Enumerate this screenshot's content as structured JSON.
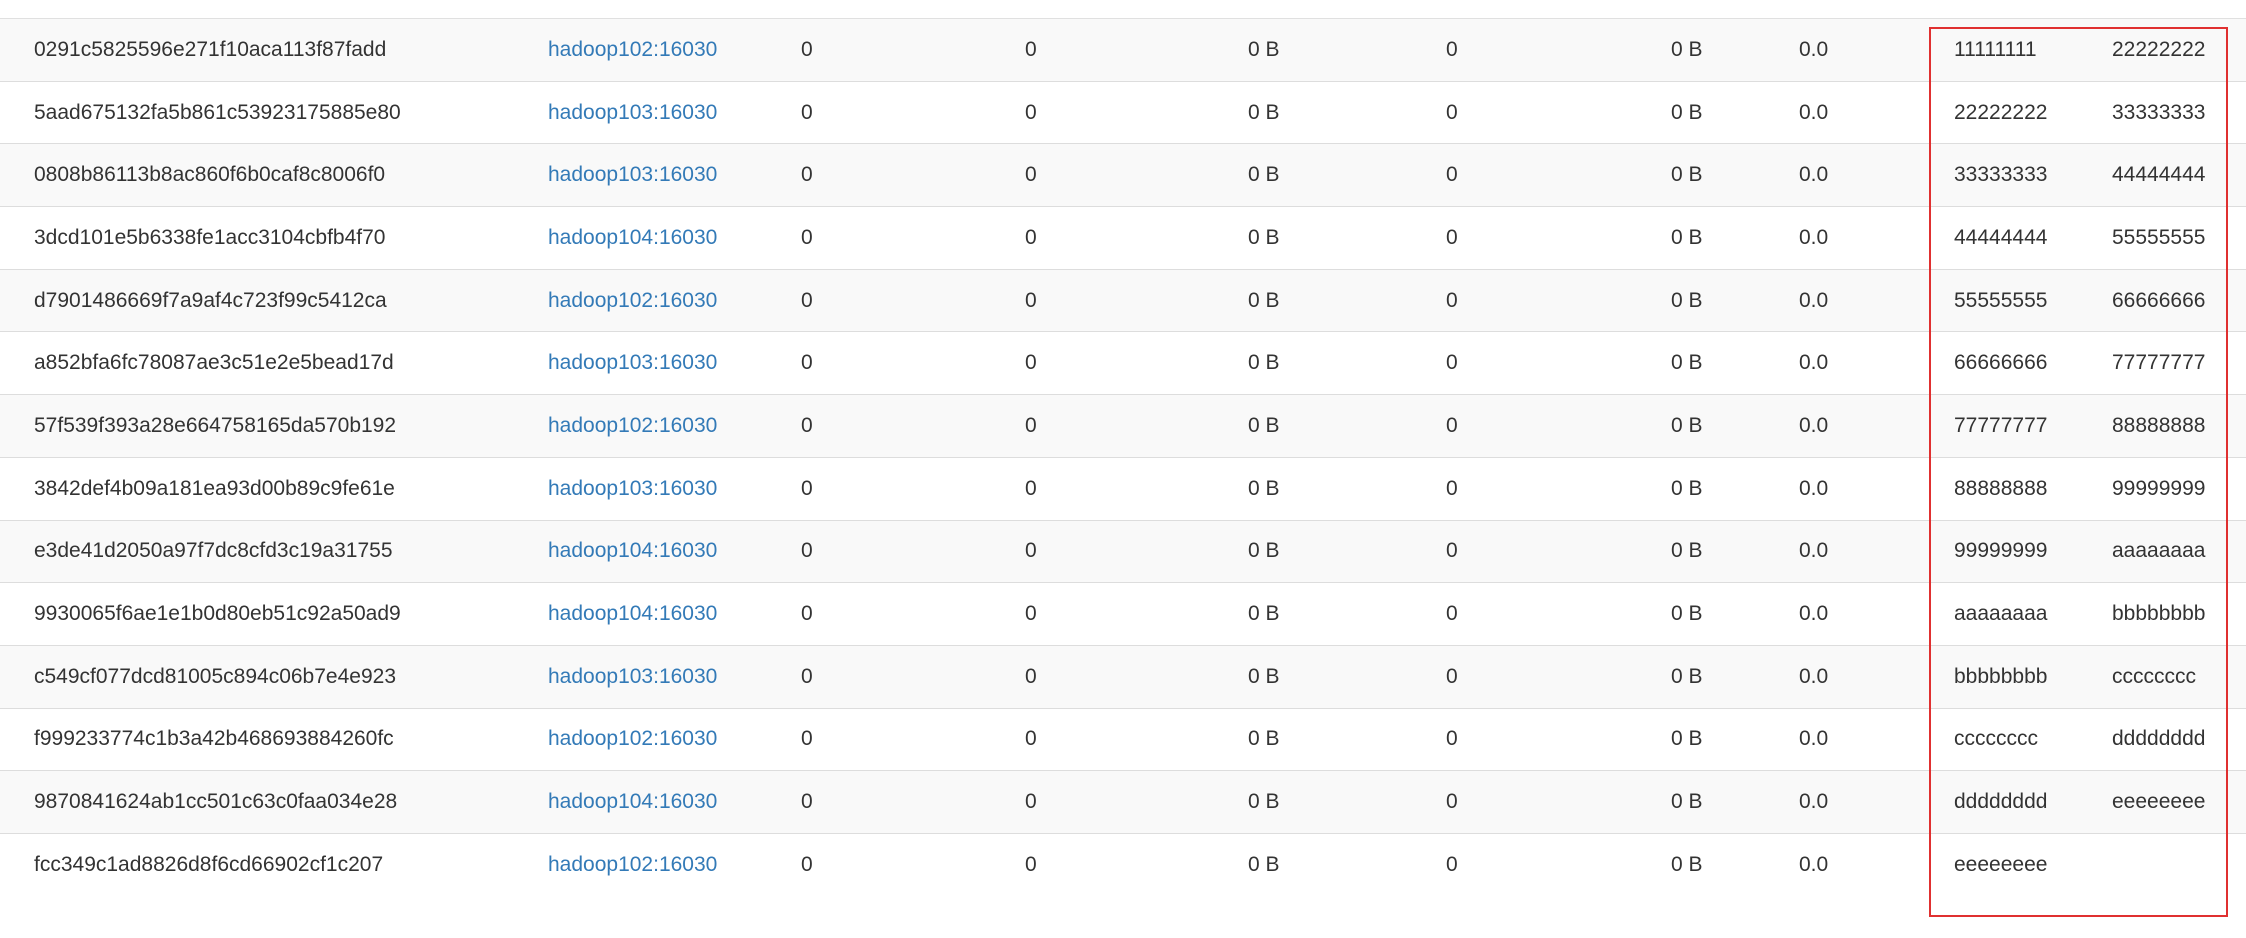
{
  "regions": {
    "rows": [
      {
        "name": "0291c5825596e271f10aca113f87fadd",
        "server": "hadoop102:16030",
        "c1": "0",
        "c2": "0",
        "c3": "0 B",
        "c4": "0",
        "c5": "0 B",
        "c6": "0.0",
        "start_key": "11111111",
        "end_key": "22222222"
      },
      {
        "name": "5aad675132fa5b861c53923175885e80",
        "server": "hadoop103:16030",
        "c1": "0",
        "c2": "0",
        "c3": "0 B",
        "c4": "0",
        "c5": "0 B",
        "c6": "0.0",
        "start_key": "22222222",
        "end_key": "33333333"
      },
      {
        "name": "0808b86113b8ac860f6b0caf8c8006f0",
        "server": "hadoop103:16030",
        "c1": "0",
        "c2": "0",
        "c3": "0 B",
        "c4": "0",
        "c5": "0 B",
        "c6": "0.0",
        "start_key": "33333333",
        "end_key": "44444444"
      },
      {
        "name": "3dcd101e5b6338fe1acc3104cbfb4f70",
        "server": "hadoop104:16030",
        "c1": "0",
        "c2": "0",
        "c3": "0 B",
        "c4": "0",
        "c5": "0 B",
        "c6": "0.0",
        "start_key": "44444444",
        "end_key": "55555555"
      },
      {
        "name": "d7901486669f7a9af4c723f99c5412ca",
        "server": "hadoop102:16030",
        "c1": "0",
        "c2": "0",
        "c3": "0 B",
        "c4": "0",
        "c5": "0 B",
        "c6": "0.0",
        "start_key": "55555555",
        "end_key": "66666666"
      },
      {
        "name": "a852bfa6fc78087ae3c51e2e5bead17d",
        "server": "hadoop103:16030",
        "c1": "0",
        "c2": "0",
        "c3": "0 B",
        "c4": "0",
        "c5": "0 B",
        "c6": "0.0",
        "start_key": "66666666",
        "end_key": "77777777"
      },
      {
        "name": "57f539f393a28e664758165da570b192",
        "server": "hadoop102:16030",
        "c1": "0",
        "c2": "0",
        "c3": "0 B",
        "c4": "0",
        "c5": "0 B",
        "c6": "0.0",
        "start_key": "77777777",
        "end_key": "88888888"
      },
      {
        "name": "3842def4b09a181ea93d00b89c9fe61e",
        "server": "hadoop103:16030",
        "c1": "0",
        "c2": "0",
        "c3": "0 B",
        "c4": "0",
        "c5": "0 B",
        "c6": "0.0",
        "start_key": "88888888",
        "end_key": "99999999"
      },
      {
        "name": "e3de41d2050a97f7dc8cfd3c19a31755",
        "server": "hadoop104:16030",
        "c1": "0",
        "c2": "0",
        "c3": "0 B",
        "c4": "0",
        "c5": "0 B",
        "c6": "0.0",
        "start_key": "99999999",
        "end_key": "aaaaaaaa"
      },
      {
        "name": "9930065f6ae1e1b0d80eb51c92a50ad9",
        "server": "hadoop104:16030",
        "c1": "0",
        "c2": "0",
        "c3": "0 B",
        "c4": "0",
        "c5": "0 B",
        "c6": "0.0",
        "start_key": "aaaaaaaa",
        "end_key": "bbbbbbbb"
      },
      {
        "name": "c549cf077dcd81005c894c06b7e4e923",
        "server": "hadoop103:16030",
        "c1": "0",
        "c2": "0",
        "c3": "0 B",
        "c4": "0",
        "c5": "0 B",
        "c6": "0.0",
        "start_key": "bbbbbbbb",
        "end_key": "cccccccc"
      },
      {
        "name": "f999233774c1b3a42b468693884260fc",
        "server": "hadoop102:16030",
        "c1": "0",
        "c2": "0",
        "c3": "0 B",
        "c4": "0",
        "c5": "0 B",
        "c6": "0.0",
        "start_key": "cccccccc",
        "end_key": "dddddddd"
      },
      {
        "name": "9870841624ab1cc501c63c0faa034e28",
        "server": "hadoop104:16030",
        "c1": "0",
        "c2": "0",
        "c3": "0 B",
        "c4": "0",
        "c5": "0 B",
        "c6": "0.0",
        "start_key": "dddddddd",
        "end_key": "eeeeeeee"
      },
      {
        "name": "fcc349c1ad8826d8f6cd66902cf1c207",
        "server": "hadoop102:16030",
        "c1": "0",
        "c2": "0",
        "c3": "0 B",
        "c4": "0",
        "c5": "0 B",
        "c6": "0.0",
        "start_key": "eeeeeeee",
        "end_key": ""
      }
    ]
  },
  "colors": {
    "link": "#337ab7",
    "highlight_border": "#e03030",
    "text": "#333333",
    "row_stripe": "#f9f9f9",
    "row_border": "#dddddd"
  }
}
